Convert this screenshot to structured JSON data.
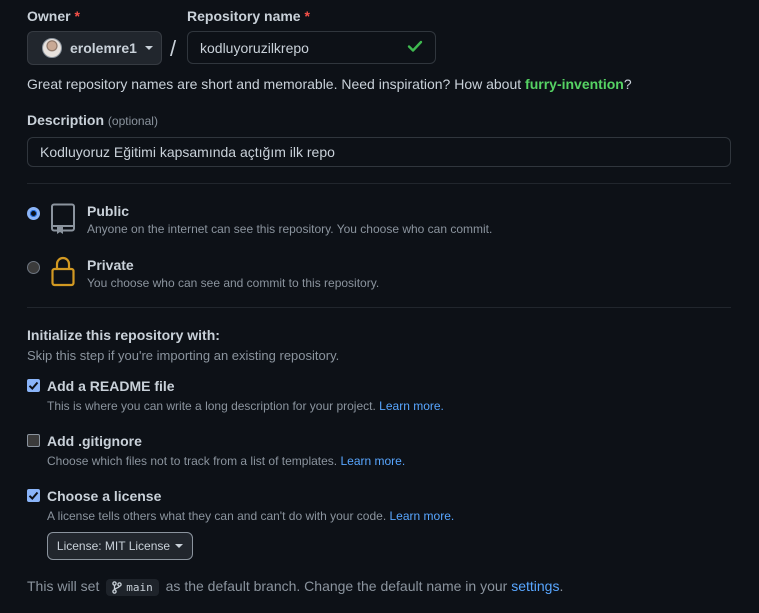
{
  "owner": {
    "label": "Owner",
    "required_mark": "*",
    "value": "erolemre1"
  },
  "repo_name": {
    "label": "Repository name",
    "required_mark": "*",
    "slash": "/",
    "value": "kodluyoruzilkrepo",
    "hint_prefix": "Great repository names are short and memorable. Need inspiration? How about ",
    "suggestion": "furry-invention",
    "hint_suffix": "?"
  },
  "description": {
    "label": "Description",
    "optional": "(optional)",
    "value": "Kodluyoruz Eğitimi kapsamında açtığım ilk repo"
  },
  "visibility": {
    "public": {
      "title": "Public",
      "desc": "Anyone on the internet can see this repository. You choose who can commit.",
      "selected": true
    },
    "private": {
      "title": "Private",
      "desc": "You choose who can see and commit to this repository.",
      "selected": false
    }
  },
  "init": {
    "title": "Initialize this repository with:",
    "subtitle": "Skip this step if you're importing an existing repository.",
    "readme": {
      "title": "Add a README file",
      "desc": "This is where you can write a long description for your project.",
      "link": "Learn more.",
      "checked": true
    },
    "gitignore": {
      "title": "Add .gitignore",
      "desc": "Choose which files not to track from a list of templates.",
      "link": "Learn more.",
      "checked": false
    },
    "license": {
      "title": "Choose a license",
      "desc": "A license tells others what they can and can't do with your code.",
      "link": "Learn more.",
      "checked": true,
      "button": "License: MIT License"
    }
  },
  "branch_note": {
    "prefix": "This will set",
    "branch": "main",
    "middle": "as the default branch. Change the default name in your",
    "link": "settings",
    "suffix": "."
  },
  "colors": {
    "background": "#0d1117",
    "accent_green": "#56d364",
    "link_blue": "#58a6ff",
    "required_red": "#f85149",
    "lock_yellow": "#d29922"
  }
}
